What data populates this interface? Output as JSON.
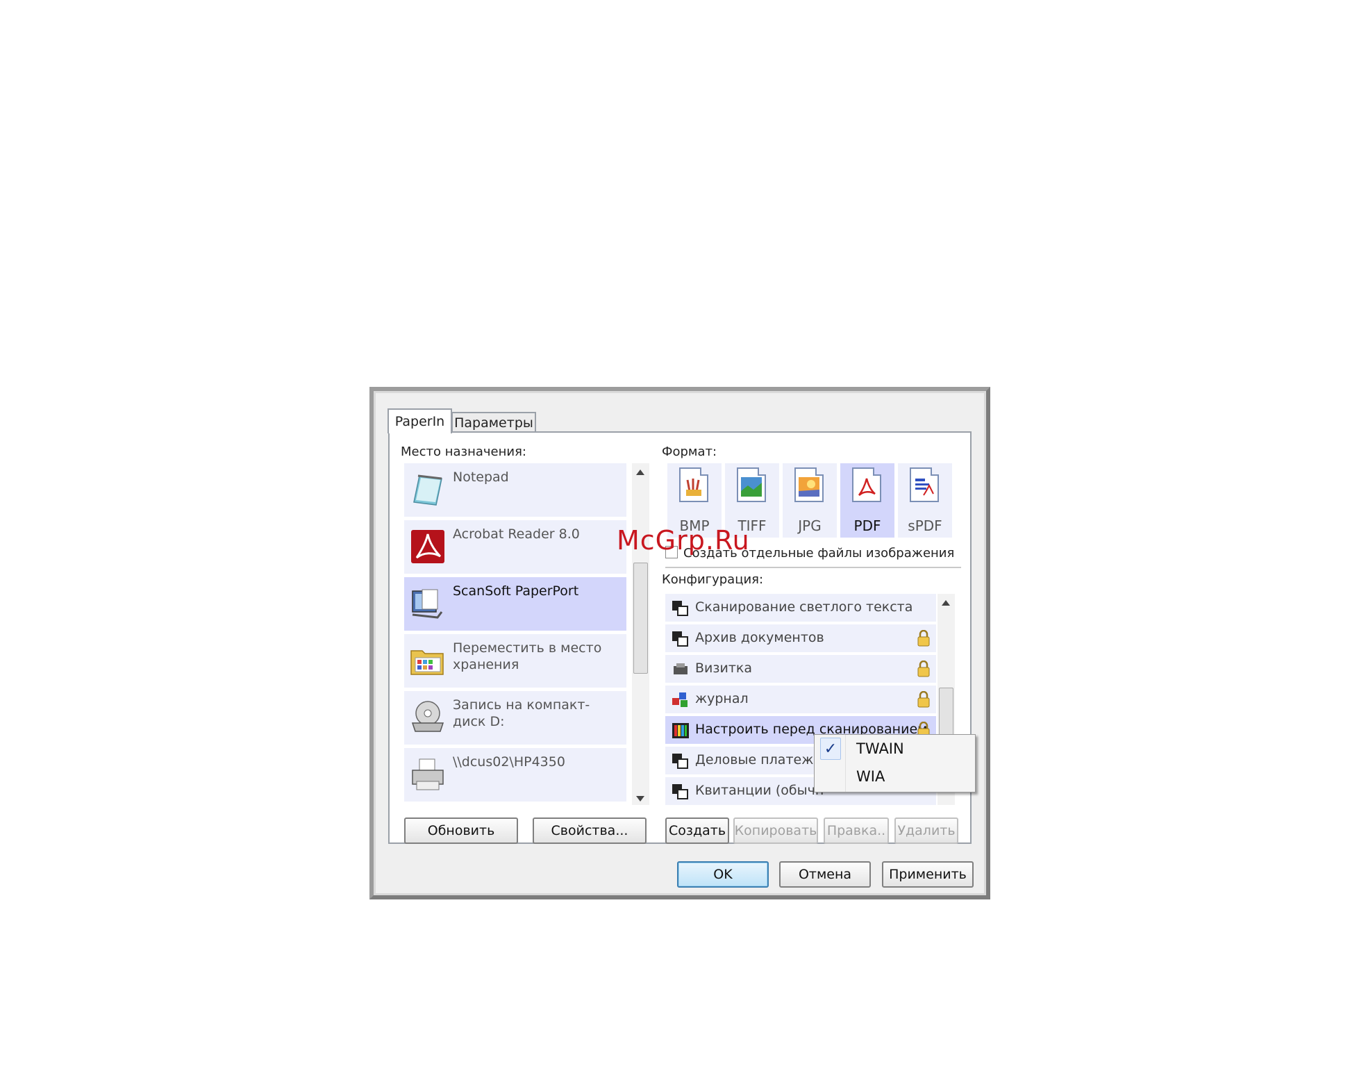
{
  "tabs": [
    {
      "label": "PaperIn",
      "active": true
    },
    {
      "label": "Параметры",
      "active": false
    }
  ],
  "destination": {
    "label": "Место назначения:",
    "items": [
      {
        "label": "Notepad",
        "icon": "notepad-icon"
      },
      {
        "label": "Acrobat Reader 8.0",
        "icon": "acrobat-icon"
      },
      {
        "label": "ScanSoft PaperPort",
        "icon": "paperport-icon",
        "selected": true
      },
      {
        "label": "Переместить в место хранения",
        "icon": "folder-icon"
      },
      {
        "label": "Запись на компакт-диск D:",
        "icon": "cd-drive-icon"
      },
      {
        "label": "\\\\dcus02\\HP4350",
        "icon": "printer-icon"
      }
    ],
    "refresh_button": "Обновить",
    "properties_button": "Свойства..."
  },
  "format": {
    "label": "Формат:",
    "items": [
      {
        "label": "BMP"
      },
      {
        "label": "TIFF"
      },
      {
        "label": "JPG"
      },
      {
        "label": "PDF",
        "selected": true
      },
      {
        "label": "sPDF"
      }
    ],
    "separate_files_checkbox": "Создать отдельные файлы изображения"
  },
  "configuration": {
    "label": "Конфигурация:",
    "items": [
      {
        "label": "Сканирование светлого текста",
        "locked": false
      },
      {
        "label": "Архив документов",
        "locked": true
      },
      {
        "label": "Визитка",
        "locked": true
      },
      {
        "label": "журнал",
        "locked": true
      },
      {
        "label": "Настроить перед сканированием",
        "locked": true,
        "selected": true
      },
      {
        "label": "Деловые платежн",
        "locked": false
      },
      {
        "label": "Квитанции (обычн",
        "locked": false
      }
    ],
    "create_button": "Создать",
    "copy_button": "Копировать",
    "edit_button": "Правка..",
    "delete_button": "Удалить"
  },
  "context_menu": {
    "items": [
      {
        "label": "TWAIN",
        "checked": true
      },
      {
        "label": "WIA",
        "checked": false
      }
    ]
  },
  "footer": {
    "ok_button": "OK",
    "cancel_button": "Отмена",
    "apply_button": "Применить"
  },
  "watermark": "McGrp.Ru",
  "colors": {
    "selected_bg": "#d3d6fb",
    "item_bg": "#eef0fb",
    "watermark": "#c8171f"
  }
}
